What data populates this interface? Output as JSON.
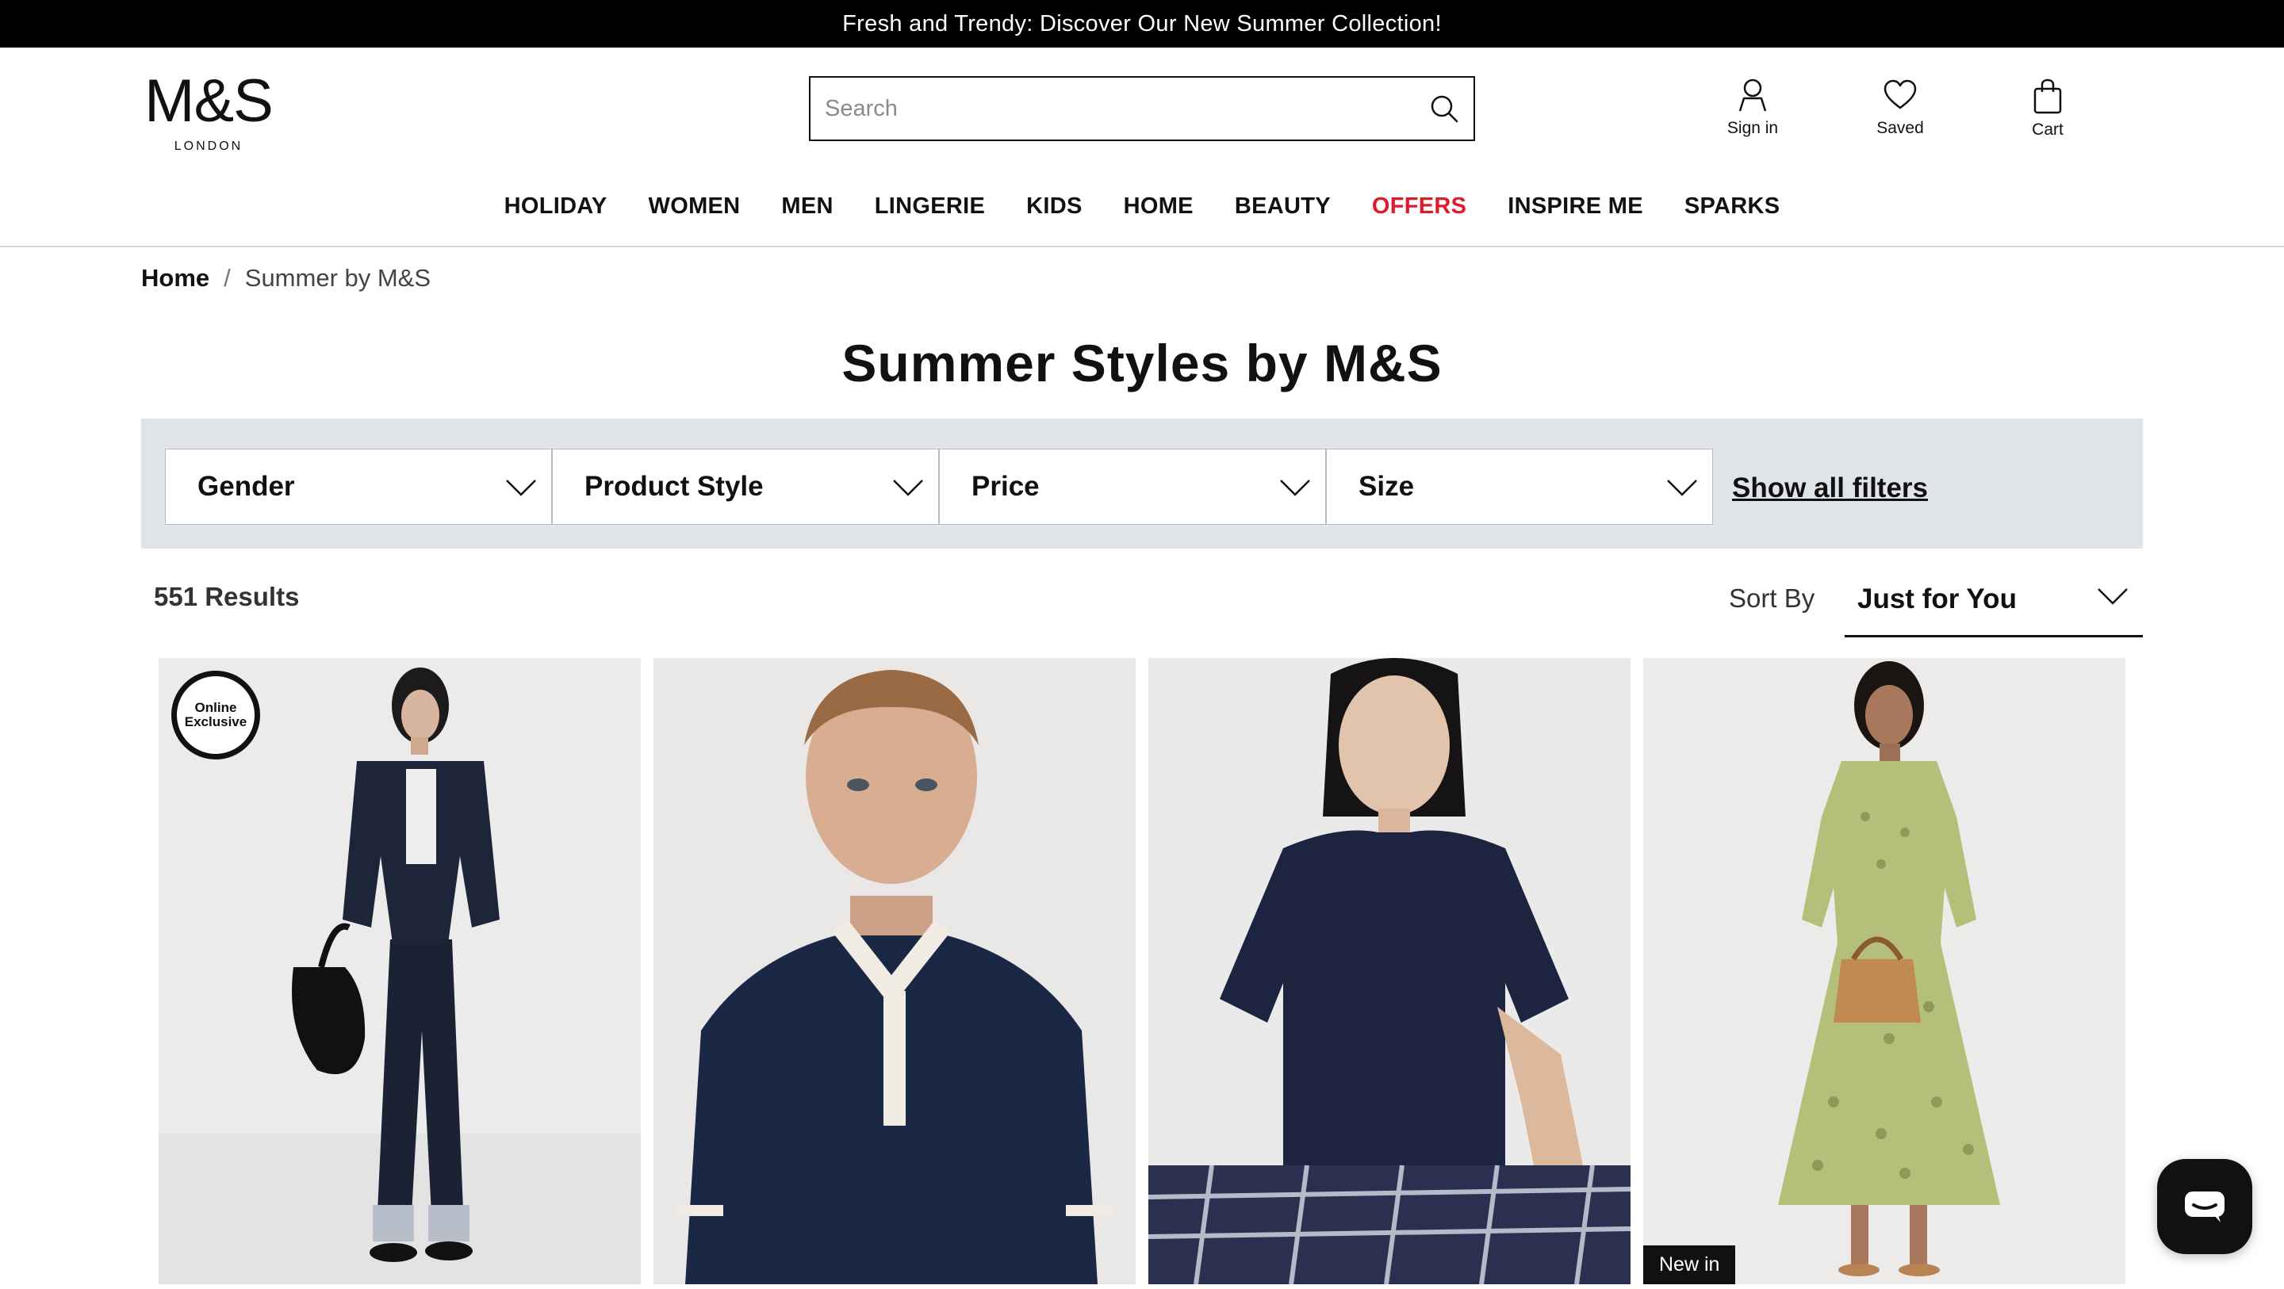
{
  "promo": {
    "text": "Fresh and Trendy: Discover Our New Summer Collection!"
  },
  "brand": {
    "logo": "M&S",
    "logo_sub": "LONDON"
  },
  "search": {
    "placeholder": "Search",
    "value": ""
  },
  "account": {
    "sign_in": "Sign in",
    "saved": "Saved",
    "cart": "Cart"
  },
  "nav": {
    "items": [
      "HOLIDAY",
      "WOMEN",
      "MEN",
      "LINGERIE",
      "KIDS",
      "HOME",
      "BEAUTY",
      "OFFERS",
      "INSPIRE ME",
      "SPARKS"
    ],
    "highlight_color": "#e01a2b"
  },
  "breadcrumb": {
    "home": "Home",
    "separator": "/",
    "current": "Summer by M&S"
  },
  "page": {
    "title": "Summer Styles by M&S"
  },
  "filters": {
    "gender": "Gender",
    "product_style": "Product Style",
    "price": "Price",
    "size": "Size",
    "show_all": "Show all filters"
  },
  "results": {
    "count": "551 Results"
  },
  "sort": {
    "label": "Sort By",
    "value": "Just for You"
  },
  "products": [
    {
      "badge": "Online Exclusive",
      "icon": "woman-denim-jacket-image"
    },
    {
      "badge": "",
      "icon": "man-navy-polo-image"
    },
    {
      "badge": "",
      "icon": "woman-navy-tshirt-image"
    },
    {
      "badge": "New in",
      "icon": "woman-green-dress-image"
    }
  ],
  "chat": {
    "icon": "chat-bubble-icon"
  }
}
